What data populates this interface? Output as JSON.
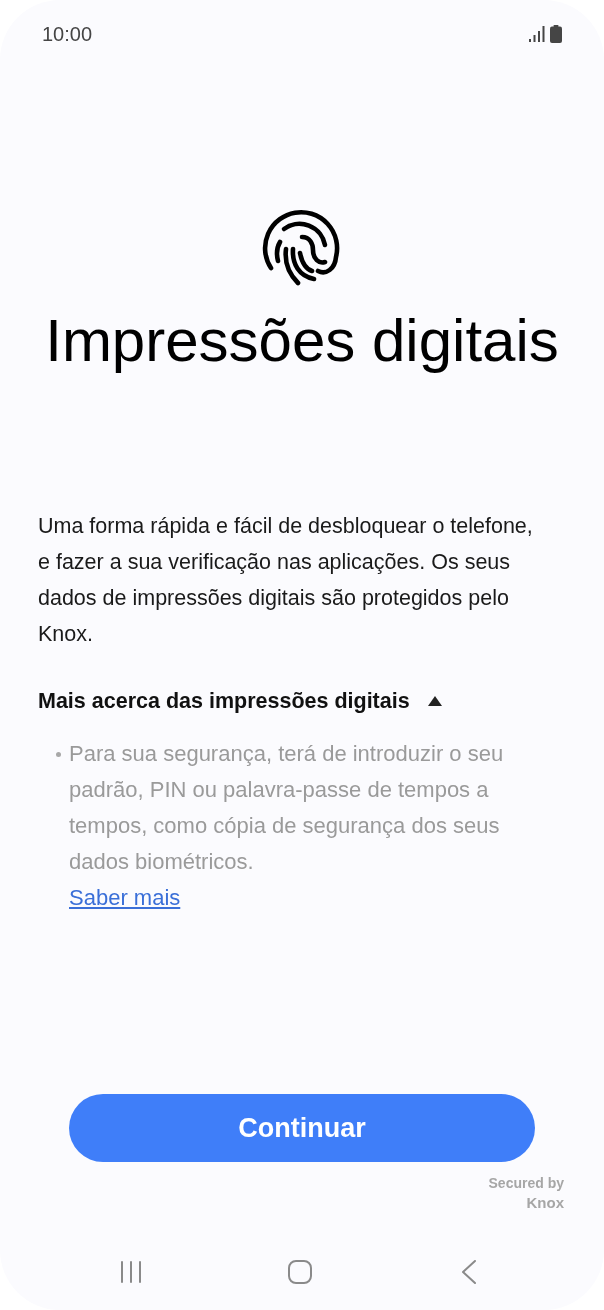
{
  "status_bar": {
    "time": "10:00"
  },
  "title": "Impressões digitais",
  "description": "Uma forma rápida e fácil de desbloquear o telefone, e fazer a sua verificação nas aplicações. Os seus dados de impressões digitais são protegidos pelo Knox.",
  "more_info": {
    "label": "Mais acerca das impressões digitais",
    "expanded": true,
    "bullets": [
      "Para sua segurança, terá de introduzir o seu padrão, PIN ou palavra-passe de tempos a tempos, como cópia de segurança dos seus dados biométricos."
    ],
    "link": "Saber mais"
  },
  "primary_button": "Continuar",
  "security_note": {
    "line_1": "Secured by",
    "line_2": "Knox"
  }
}
